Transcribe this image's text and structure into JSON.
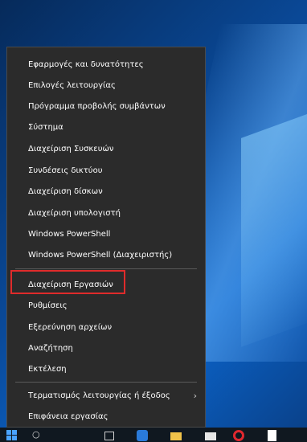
{
  "menu": {
    "items": [
      {
        "label": "Εφαρμογές και δυνατότητες"
      },
      {
        "label": "Επιλογές λειτουργίας"
      },
      {
        "label": "Πρόγραμμα προβολής συμβάντων"
      },
      {
        "label": "Σύστημα"
      },
      {
        "label": "Διαχείριση Συσκευών"
      },
      {
        "label": "Συνδέσεις δικτύου"
      },
      {
        "label": "Διαχείριση δίσκων"
      },
      {
        "label": "Διαχείριση υπολογιστή"
      },
      {
        "label": "Windows PowerShell"
      },
      {
        "label": "Windows PowerShell (Διαχειριστής)"
      },
      {
        "label": "Διαχείριση Εργασιών"
      },
      {
        "label": "Ρυθμίσεις"
      },
      {
        "label": "Εξερεύνηση αρχείων"
      },
      {
        "label": "Αναζήτηση"
      },
      {
        "label": "Εκτέλεση"
      },
      {
        "label": "Τερματισμός λειτουργίας ή έξοδος"
      },
      {
        "label": "Επιφάνεια εργασίας"
      }
    ],
    "submenu_chevron": "›"
  },
  "colors": {
    "menu_bg": "#2b2b2b",
    "highlight_border": "#e02b2b",
    "taskbar_bg": "#101820"
  },
  "taskbar": {
    "icons": [
      "windows-start-icon",
      "search-icon",
      "task-view-icon",
      "edge-icon",
      "file-explorer-icon",
      "mail-icon",
      "opera-icon",
      "file-icon"
    ]
  }
}
